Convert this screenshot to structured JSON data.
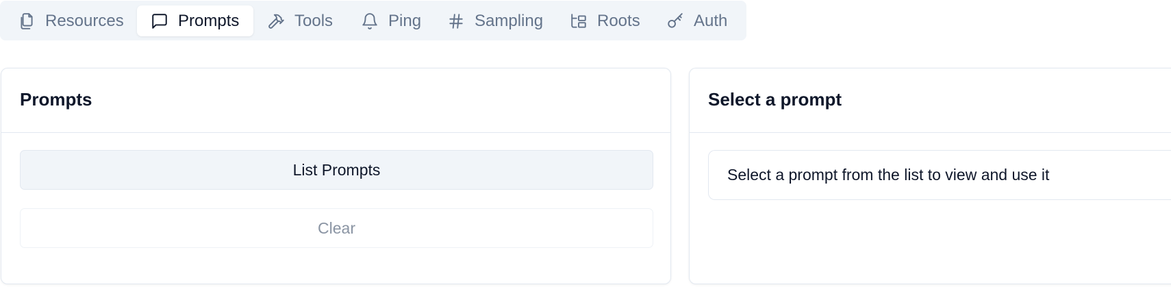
{
  "tabs": [
    {
      "label": "Resources",
      "icon": "files-icon",
      "active": false
    },
    {
      "label": "Prompts",
      "icon": "message-square-icon",
      "active": true
    },
    {
      "label": "Tools",
      "icon": "hammer-icon",
      "active": false
    },
    {
      "label": "Ping",
      "icon": "bell-icon",
      "active": false
    },
    {
      "label": "Sampling",
      "icon": "hash-icon",
      "active": false
    },
    {
      "label": "Roots",
      "icon": "folder-tree-icon",
      "active": false
    },
    {
      "label": "Auth",
      "icon": "key-icon",
      "active": false
    }
  ],
  "prompts_panel": {
    "title": "Prompts",
    "list_button": "List Prompts",
    "clear_button": "Clear"
  },
  "detail_panel": {
    "title": "Select a prompt",
    "placeholder": "Select a prompt from the list to view and use it"
  },
  "colors": {
    "tab_bar_bg": "#f1f5f9",
    "inactive_text": "#64748b",
    "active_text": "#0f172a",
    "border": "#e2e8f0"
  }
}
